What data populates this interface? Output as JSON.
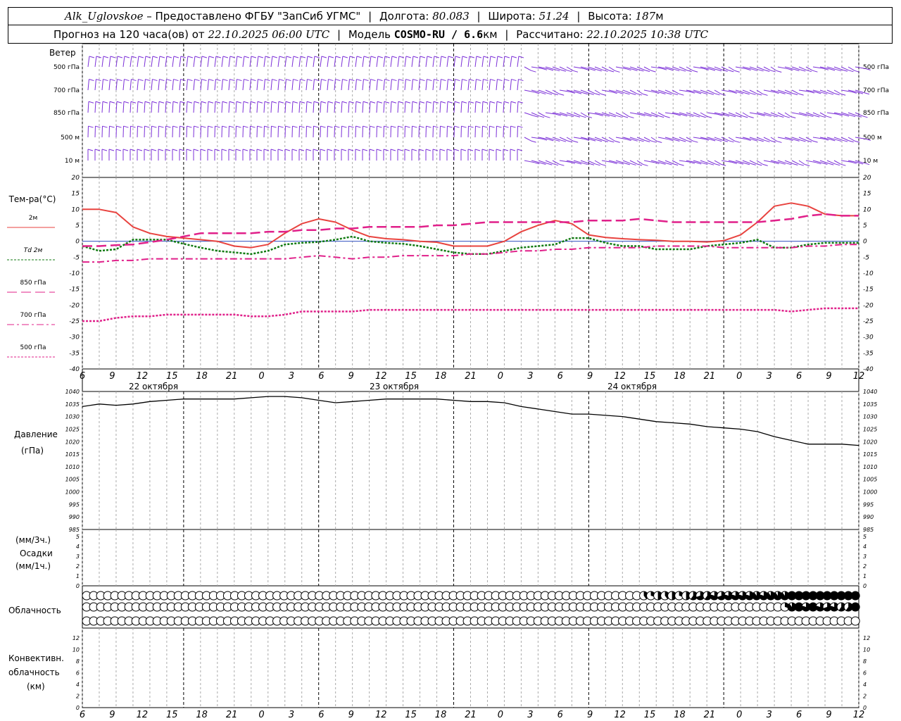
{
  "header": {
    "station": "Alk_Uglovskoe",
    "provider": "– Предоставлено ФГБУ \"ЗапСиб УГМС\"",
    "lon_label": "Долгота:",
    "lon": "80.083",
    "lat_label": "Широта:",
    "lat": "51.24",
    "alt_label": "Высота:",
    "alt": "187",
    "alt_unit": "м",
    "forecast_label": "Прогноз на 120 часа(ов) от",
    "forecast_time": "22.10.2025 06:00 UTC",
    "model_label": "Модель",
    "model": "COSMO-RU / 6.6",
    "model_unit": "км",
    "calc_label": "Рассчитано:",
    "calc_time": "22.10.2025 10:38 UTC"
  },
  "wind_panel": {
    "title": "Ветер",
    "levels": [
      "500 гПа",
      "700 гПа",
      "850 гПа",
      "500 м",
      "10 м"
    ],
    "barb_color": "#7b2fd8"
  },
  "temp_panel": {
    "title": "Тем-ра(°C)",
    "legend": [
      {
        "label": "2м",
        "color": "#e8433f",
        "style": "solid"
      },
      {
        "label": "Td 2м",
        "color": "#107a10",
        "style": "dotted"
      },
      {
        "label": "850 гПа",
        "color": "#e0208a",
        "style": "longdash"
      },
      {
        "label": "700 гПа",
        "color": "#e0208a",
        "style": "dashdot"
      },
      {
        "label": "500 гПа",
        "color": "#e0208a",
        "style": "dotted"
      }
    ],
    "yticks": [
      "20",
      "15",
      "10",
      "5",
      "0",
      "-5",
      "-10",
      "-15",
      "-20",
      "-25",
      "-30",
      "-35",
      "-40"
    ]
  },
  "x_axis": {
    "tick_labels": [
      "6",
      "9",
      "12",
      "15",
      "18",
      "21",
      "0",
      "3",
      "6",
      "9",
      "12",
      "15",
      "18",
      "21",
      "0",
      "3",
      "6",
      "9",
      "12",
      "15",
      "18",
      "21",
      "0",
      "3",
      "6",
      "9",
      "12"
    ],
    "date_labels": [
      "22 октября",
      "23 октября",
      "24 октября"
    ]
  },
  "pressure_panel": {
    "title": "Давление",
    "unit": "(гПа)",
    "yticks": [
      "1040",
      "1035",
      "1030",
      "1025",
      "1020",
      "1015",
      "1010",
      "1005",
      "1000",
      "995",
      "990",
      "985"
    ]
  },
  "precip_panel": {
    "unit_3h": "(мм/3ч.)",
    "title": "Осадки",
    "unit_1h": "(мм/1ч.)",
    "yticks": [
      "5",
      "4",
      "3",
      "2",
      "1",
      "0"
    ]
  },
  "cloud_panel": {
    "title": "Облачность"
  },
  "conv_panel": {
    "title_1": "Конвективн.",
    "title_2": "облачность",
    "unit": "(км)",
    "yticks": [
      "12",
      "10",
      "8",
      "6",
      "4",
      "2",
      "0"
    ]
  },
  "chart_data": [
    {
      "type": "line",
      "title": "Тем-ра(°C)",
      "x_hours": [
        0,
        3,
        6,
        9,
        12,
        15,
        18,
        21,
        24,
        27,
        30,
        33,
        36,
        39,
        42,
        45,
        48,
        51,
        54,
        57,
        60,
        63,
        66,
        69,
        72,
        75,
        78,
        81,
        84,
        87,
        90,
        93,
        96,
        99,
        102,
        105,
        108,
        111,
        114,
        117,
        120,
        123,
        126,
        129,
        132,
        135,
        138
      ],
      "ylim": [
        -40,
        20
      ],
      "series": [
        {
          "name": "2м",
          "values": [
            10,
            10,
            9,
            4.5,
            2.5,
            1.5,
            1,
            0.5,
            0,
            -1.5,
            -2,
            -1,
            2.5,
            5.5,
            7,
            6,
            3.5,
            1.5,
            0.8,
            0.5,
            0,
            -0.3,
            -1.5,
            -1.5,
            -1.5,
            0,
            3,
            5,
            6.5,
            5.5,
            2,
            1.2,
            0.8,
            0.5,
            0.3,
            0,
            0,
            -0.2,
            0.2,
            2,
            6,
            11,
            12,
            11,
            8.5,
            8,
            8
          ]
        },
        {
          "name": "Td 2м",
          "values": [
            -1.5,
            -3,
            -2.5,
            0.5,
            0.5,
            0.5,
            -0.8,
            -2,
            -3,
            -3.5,
            -4,
            -3,
            -1,
            -0.5,
            -0.2,
            0.5,
            1.5,
            0,
            -0.5,
            -0.8,
            -1.5,
            -2.5,
            -3.5,
            -4,
            -4,
            -3,
            -2,
            -1.5,
            -1,
            1,
            1,
            -0.5,
            -1.5,
            -1.5,
            -2.5,
            -2.5,
            -2.5,
            -1.5,
            -1,
            -0.5,
            0.5,
            -2,
            -2,
            -1,
            -0.5,
            -0.5,
            -0.5
          ]
        },
        {
          "name": "850 гПа",
          "values": [
            -1.5,
            -1.5,
            -1.2,
            -1,
            -0.3,
            0.5,
            1.5,
            2.5,
            2.5,
            2.5,
            2.5,
            3,
            3,
            3.5,
            3.5,
            4,
            4,
            4.5,
            4.5,
            4.5,
            4.5,
            5,
            5,
            5.5,
            6,
            6,
            6,
            6,
            6,
            6,
            6.5,
            6.5,
            6.5,
            7,
            6.5,
            6,
            6,
            6,
            6,
            6,
            6,
            6.5,
            7,
            8,
            8.5,
            8,
            8
          ]
        },
        {
          "name": "700 гПа",
          "values": [
            -6.5,
            -6.5,
            -6,
            -6,
            -5.5,
            -5.5,
            -5.5,
            -5.5,
            -5.5,
            -5.5,
            -5.5,
            -5.5,
            -5.5,
            -5,
            -4.5,
            -5,
            -5.5,
            -5,
            -5,
            -4.5,
            -4.5,
            -4.5,
            -4.5,
            -4,
            -4,
            -3.5,
            -3,
            -3,
            -2.5,
            -2.5,
            -2,
            -2,
            -2,
            -2,
            -1.5,
            -1.5,
            -1.5,
            -1.5,
            -2,
            -2,
            -2,
            -2,
            -2,
            -1.5,
            -1.5,
            -1,
            -1
          ]
        },
        {
          "name": "500 гПа",
          "values": [
            -25,
            -25,
            -24,
            -23.5,
            -23.5,
            -23,
            -23,
            -23,
            -23,
            -23,
            -23.5,
            -23.5,
            -23,
            -22,
            -22,
            -22,
            -22,
            -21.5,
            -21.5,
            -21.5,
            -21.5,
            -21.5,
            -21.5,
            -21.5,
            -21.5,
            -21.5,
            -21.5,
            -21.5,
            -21.5,
            -21.5,
            -21.5,
            -21.5,
            -21.5,
            -21.5,
            -21.5,
            -21.5,
            -21.5,
            -21.5,
            -21.5,
            -21.5,
            -21.5,
            -21.5,
            -22,
            -21.5,
            -21,
            -21,
            -21
          ]
        }
      ]
    },
    {
      "type": "line",
      "title": "Давление",
      "x_hours": [
        0,
        3,
        6,
        9,
        12,
        15,
        18,
        21,
        24,
        27,
        30,
        33,
        36,
        39,
        42,
        45,
        48,
        51,
        54,
        57,
        60,
        63,
        66,
        69,
        72,
        75,
        78,
        81,
        84,
        87,
        90,
        93,
        96,
        99,
        102,
        105,
        108,
        111,
        114,
        117,
        120,
        123,
        126,
        129,
        132,
        135,
        138
      ],
      "ylim": [
        985,
        1040
      ],
      "series": [
        {
          "name": "Давление",
          "values": [
            1034,
            1035,
            1034.5,
            1035,
            1036,
            1036.5,
            1037,
            1037,
            1037,
            1037,
            1037.5,
            1038,
            1038,
            1037.5,
            1036.5,
            1035.5,
            1036,
            1036.5,
            1037,
            1037,
            1037,
            1037,
            1036.5,
            1036,
            1036,
            1035.5,
            1034,
            1033,
            1032,
            1031,
            1031,
            1030.5,
            1030,
            1029,
            1028,
            1027.5,
            1027,
            1026,
            1025.5,
            1025,
            1024,
            1022,
            1020.5,
            1019,
            1019,
            1019,
            1018.5
          ]
        }
      ]
    },
    {
      "type": "bar",
      "title": "Осадки",
      "ylim": [
        0,
        5
      ],
      "values": []
    },
    {
      "type": "table",
      "title": "Облачность",
      "rows": 3,
      "x_hours_step": 1,
      "layer_fractions": [
        [
          0,
          0,
          0,
          0,
          0,
          0,
          0,
          0,
          0,
          0,
          0,
          0,
          0,
          0,
          0,
          0,
          0,
          0,
          0,
          0,
          0,
          0,
          0,
          0,
          0,
          0,
          0,
          0,
          0,
          0,
          0,
          0,
          0,
          0,
          0,
          0,
          0,
          0,
          0,
          0,
          0,
          0,
          0,
          0,
          0,
          0,
          0,
          0,
          0,
          0,
          0,
          0,
          0,
          0,
          0,
          0,
          0,
          0,
          0,
          0,
          0,
          0,
          0,
          0,
          0,
          0,
          0,
          0,
          0,
          0,
          0,
          0,
          0,
          0,
          0,
          0,
          0,
          0,
          0,
          0.4,
          0.3,
          0.5,
          0.4,
          0.5,
          0.3,
          0.5,
          0.6,
          0.7,
          0.6,
          0.8,
          0.7,
          0.8,
          0.8,
          0.8,
          0.8,
          0.9,
          0.8,
          0.9,
          0.9,
          0.9,
          1,
          1,
          1,
          1,
          1,
          1,
          1,
          1,
          1,
          1
        ],
        [
          0,
          0,
          0,
          0,
          0,
          0,
          0,
          0,
          0,
          0,
          0,
          0,
          0,
          0,
          0,
          0,
          0,
          0,
          0,
          0,
          0,
          0,
          0,
          0,
          0,
          0,
          0,
          0,
          0,
          0,
          0,
          0,
          0,
          0,
          0,
          0,
          0,
          0,
          0,
          0,
          0,
          0,
          0,
          0,
          0,
          0,
          0,
          0,
          0,
          0,
          0,
          0,
          0,
          0,
          0,
          0,
          0,
          0,
          0,
          0,
          0,
          0,
          0,
          0,
          0,
          0,
          0,
          0,
          0,
          0,
          0,
          0,
          0,
          0,
          0,
          0,
          0,
          0,
          0,
          0,
          0,
          0,
          0,
          0,
          0,
          0,
          0,
          0,
          0,
          0,
          0,
          0,
          0,
          0,
          0,
          0,
          0,
          0,
          0,
          0.3,
          0.9,
          1,
          0.8,
          1,
          0.8,
          0.7,
          0.8,
          0.6,
          0.6,
          1
        ],
        [
          0,
          0,
          0,
          0,
          0,
          0,
          0,
          0,
          0,
          0,
          0,
          0,
          0,
          0,
          0,
          0,
          0,
          0,
          0,
          0,
          0,
          0,
          0,
          0,
          0,
          0,
          0,
          0,
          0,
          0,
          0,
          0,
          0,
          0,
          0,
          0,
          0,
          0,
          0,
          0,
          0,
          0,
          0,
          0,
          0,
          0,
          0,
          0,
          0,
          0,
          0,
          0,
          0,
          0,
          0,
          0,
          0,
          0,
          0,
          0,
          0,
          0,
          0,
          0,
          0,
          0,
          0,
          0,
          0,
          0,
          0,
          0,
          0,
          0,
          0,
          0,
          0,
          0,
          0,
          0,
          0,
          0,
          0,
          0,
          0,
          0,
          0,
          0,
          0,
          0,
          0,
          0,
          0,
          0,
          0,
          0,
          0,
          0,
          0,
          0,
          0,
          0,
          0,
          0,
          0,
          0,
          0,
          0,
          0,
          0
        ]
      ]
    },
    {
      "type": "bar",
      "title": "Конвективн. облачность",
      "ylim": [
        0,
        13
      ],
      "values": []
    }
  ]
}
